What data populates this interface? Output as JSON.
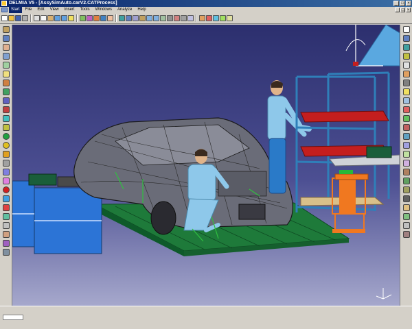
{
  "window": {
    "title": "DELMIA V5 - [AssySimAuto.carV2.CATProcess]",
    "controls": [
      "_",
      "□",
      "×"
    ]
  },
  "menu": {
    "items": [
      "Start",
      "File",
      "Edit",
      "View",
      "Insert",
      "Tools",
      "Windows",
      "Analyze",
      "Help"
    ],
    "active": "Start"
  },
  "colors": {
    "viewport_top": "#2c2f6e",
    "viewport_bottom": "#a6a8cc",
    "titlebar": "#0a246a",
    "rack_frame": "#2f7fb9",
    "bins": "#c41e1e",
    "cabinet": "#2c74d6",
    "trolley": "#f07820",
    "platform": "#1e7a3a",
    "worker_shirt": "#8ec8ea",
    "worker_pants": "#2a7ac8"
  },
  "scene": {
    "objects": [
      "car-body-wireframe",
      "standing-worker",
      "crouching-worker",
      "parts-rack",
      "parts-cabinet",
      "orange-trolley",
      "assembly-platform",
      "compass"
    ]
  }
}
